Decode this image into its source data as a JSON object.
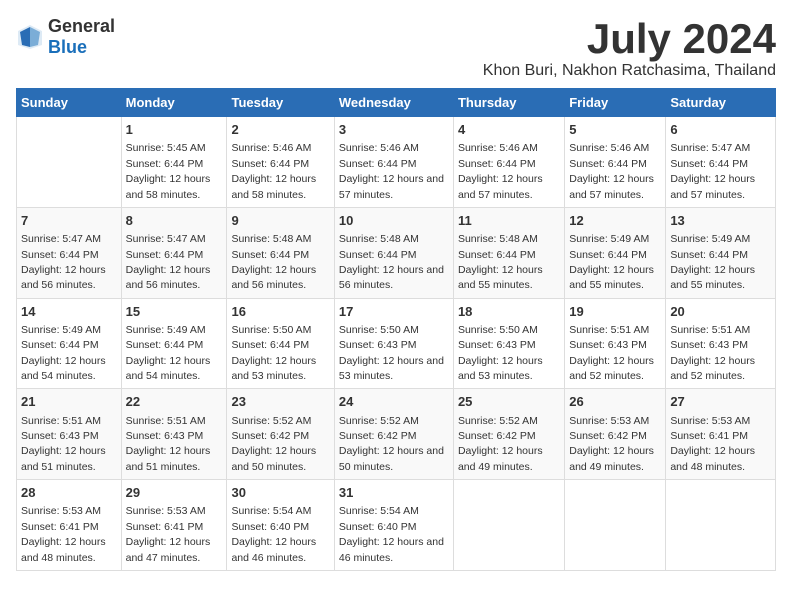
{
  "header": {
    "logo_general": "General",
    "logo_blue": "Blue",
    "title": "July 2024",
    "location": "Khon Buri, Nakhon Ratchasima, Thailand"
  },
  "weekdays": [
    "Sunday",
    "Monday",
    "Tuesday",
    "Wednesday",
    "Thursday",
    "Friday",
    "Saturday"
  ],
  "weeks": [
    [
      {
        "day": "",
        "sunrise": "",
        "sunset": "",
        "daylight": ""
      },
      {
        "day": "1",
        "sunrise": "Sunrise: 5:45 AM",
        "sunset": "Sunset: 6:44 PM",
        "daylight": "Daylight: 12 hours and 58 minutes."
      },
      {
        "day": "2",
        "sunrise": "Sunrise: 5:46 AM",
        "sunset": "Sunset: 6:44 PM",
        "daylight": "Daylight: 12 hours and 58 minutes."
      },
      {
        "day": "3",
        "sunrise": "Sunrise: 5:46 AM",
        "sunset": "Sunset: 6:44 PM",
        "daylight": "Daylight: 12 hours and 57 minutes."
      },
      {
        "day": "4",
        "sunrise": "Sunrise: 5:46 AM",
        "sunset": "Sunset: 6:44 PM",
        "daylight": "Daylight: 12 hours and 57 minutes."
      },
      {
        "day": "5",
        "sunrise": "Sunrise: 5:46 AM",
        "sunset": "Sunset: 6:44 PM",
        "daylight": "Daylight: 12 hours and 57 minutes."
      },
      {
        "day": "6",
        "sunrise": "Sunrise: 5:47 AM",
        "sunset": "Sunset: 6:44 PM",
        "daylight": "Daylight: 12 hours and 57 minutes."
      }
    ],
    [
      {
        "day": "7",
        "sunrise": "Sunrise: 5:47 AM",
        "sunset": "Sunset: 6:44 PM",
        "daylight": "Daylight: 12 hours and 56 minutes."
      },
      {
        "day": "8",
        "sunrise": "Sunrise: 5:47 AM",
        "sunset": "Sunset: 6:44 PM",
        "daylight": "Daylight: 12 hours and 56 minutes."
      },
      {
        "day": "9",
        "sunrise": "Sunrise: 5:48 AM",
        "sunset": "Sunset: 6:44 PM",
        "daylight": "Daylight: 12 hours and 56 minutes."
      },
      {
        "day": "10",
        "sunrise": "Sunrise: 5:48 AM",
        "sunset": "Sunset: 6:44 PM",
        "daylight": "Daylight: 12 hours and 56 minutes."
      },
      {
        "day": "11",
        "sunrise": "Sunrise: 5:48 AM",
        "sunset": "Sunset: 6:44 PM",
        "daylight": "Daylight: 12 hours and 55 minutes."
      },
      {
        "day": "12",
        "sunrise": "Sunrise: 5:49 AM",
        "sunset": "Sunset: 6:44 PM",
        "daylight": "Daylight: 12 hours and 55 minutes."
      },
      {
        "day": "13",
        "sunrise": "Sunrise: 5:49 AM",
        "sunset": "Sunset: 6:44 PM",
        "daylight": "Daylight: 12 hours and 55 minutes."
      }
    ],
    [
      {
        "day": "14",
        "sunrise": "Sunrise: 5:49 AM",
        "sunset": "Sunset: 6:44 PM",
        "daylight": "Daylight: 12 hours and 54 minutes."
      },
      {
        "day": "15",
        "sunrise": "Sunrise: 5:49 AM",
        "sunset": "Sunset: 6:44 PM",
        "daylight": "Daylight: 12 hours and 54 minutes."
      },
      {
        "day": "16",
        "sunrise": "Sunrise: 5:50 AM",
        "sunset": "Sunset: 6:44 PM",
        "daylight": "Daylight: 12 hours and 53 minutes."
      },
      {
        "day": "17",
        "sunrise": "Sunrise: 5:50 AM",
        "sunset": "Sunset: 6:43 PM",
        "daylight": "Daylight: 12 hours and 53 minutes."
      },
      {
        "day": "18",
        "sunrise": "Sunrise: 5:50 AM",
        "sunset": "Sunset: 6:43 PM",
        "daylight": "Daylight: 12 hours and 53 minutes."
      },
      {
        "day": "19",
        "sunrise": "Sunrise: 5:51 AM",
        "sunset": "Sunset: 6:43 PM",
        "daylight": "Daylight: 12 hours and 52 minutes."
      },
      {
        "day": "20",
        "sunrise": "Sunrise: 5:51 AM",
        "sunset": "Sunset: 6:43 PM",
        "daylight": "Daylight: 12 hours and 52 minutes."
      }
    ],
    [
      {
        "day": "21",
        "sunrise": "Sunrise: 5:51 AM",
        "sunset": "Sunset: 6:43 PM",
        "daylight": "Daylight: 12 hours and 51 minutes."
      },
      {
        "day": "22",
        "sunrise": "Sunrise: 5:51 AM",
        "sunset": "Sunset: 6:43 PM",
        "daylight": "Daylight: 12 hours and 51 minutes."
      },
      {
        "day": "23",
        "sunrise": "Sunrise: 5:52 AM",
        "sunset": "Sunset: 6:42 PM",
        "daylight": "Daylight: 12 hours and 50 minutes."
      },
      {
        "day": "24",
        "sunrise": "Sunrise: 5:52 AM",
        "sunset": "Sunset: 6:42 PM",
        "daylight": "Daylight: 12 hours and 50 minutes."
      },
      {
        "day": "25",
        "sunrise": "Sunrise: 5:52 AM",
        "sunset": "Sunset: 6:42 PM",
        "daylight": "Daylight: 12 hours and 49 minutes."
      },
      {
        "day": "26",
        "sunrise": "Sunrise: 5:53 AM",
        "sunset": "Sunset: 6:42 PM",
        "daylight": "Daylight: 12 hours and 49 minutes."
      },
      {
        "day": "27",
        "sunrise": "Sunrise: 5:53 AM",
        "sunset": "Sunset: 6:41 PM",
        "daylight": "Daylight: 12 hours and 48 minutes."
      }
    ],
    [
      {
        "day": "28",
        "sunrise": "Sunrise: 5:53 AM",
        "sunset": "Sunset: 6:41 PM",
        "daylight": "Daylight: 12 hours and 48 minutes."
      },
      {
        "day": "29",
        "sunrise": "Sunrise: 5:53 AM",
        "sunset": "Sunset: 6:41 PM",
        "daylight": "Daylight: 12 hours and 47 minutes."
      },
      {
        "day": "30",
        "sunrise": "Sunrise: 5:54 AM",
        "sunset": "Sunset: 6:40 PM",
        "daylight": "Daylight: 12 hours and 46 minutes."
      },
      {
        "day": "31",
        "sunrise": "Sunrise: 5:54 AM",
        "sunset": "Sunset: 6:40 PM",
        "daylight": "Daylight: 12 hours and 46 minutes."
      },
      {
        "day": "",
        "sunrise": "",
        "sunset": "",
        "daylight": ""
      },
      {
        "day": "",
        "sunrise": "",
        "sunset": "",
        "daylight": ""
      },
      {
        "day": "",
        "sunrise": "",
        "sunset": "",
        "daylight": ""
      }
    ]
  ]
}
